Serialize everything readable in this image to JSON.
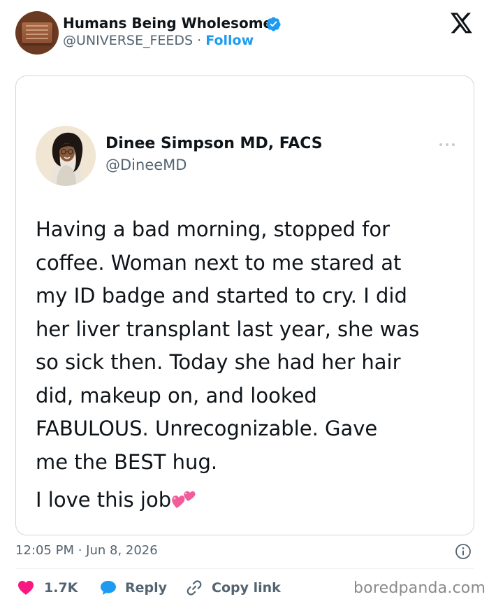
{
  "author": {
    "name": "Humans Being Wholesome",
    "handle": "@UNIVERSE_FEEDS",
    "separator": " · ",
    "follow_label": "Follow"
  },
  "embedded_tweet": {
    "name": "Dinee Simpson MD, FACS",
    "handle": "@DineeMD",
    "body_lines": [
      "Having a bad morning, stopped for",
      "coffee. Woman next to me stared at",
      "my ID badge and started to cry. I did",
      "her liver transplant last year, she was",
      "so sick then. Today she had her hair",
      "did, makeup on, and looked",
      "FABULOUS.  Unrecognizable. Gave",
      "me the BEST hug."
    ],
    "closing": "I love this job"
  },
  "footer": {
    "timestamp": "12:05 PM · Jun 8, 2026",
    "like_count": "1.7K",
    "reply_label": "Reply",
    "copy_link_label": "Copy link"
  },
  "watermark": "boredpanda.com",
  "icons": {
    "verified": "verified-badge-icon",
    "brand": "x-logo-icon",
    "more": "more-options-icon",
    "heart_emoji": "two-hearts-emoji-icon",
    "info": "info-icon",
    "like": "heart-icon",
    "reply": "speech-bubble-icon",
    "copy": "link-icon"
  },
  "colors": {
    "accent": "#1d9bf0",
    "like": "#f91880",
    "text_primary": "#0f1419",
    "text_secondary": "#536471",
    "card_border": "#cfd9de"
  }
}
